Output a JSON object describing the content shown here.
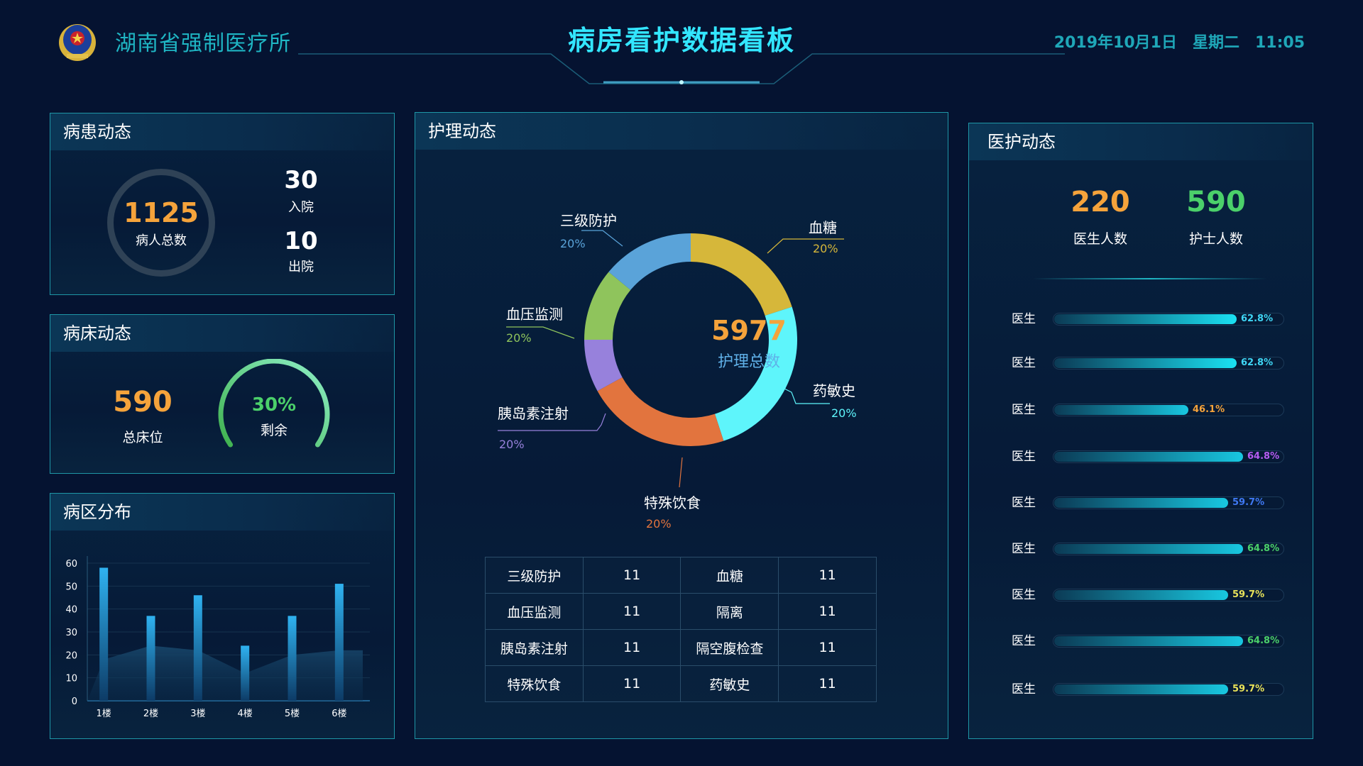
{
  "header": {
    "org_name": "湖南省强制医疗所",
    "title": "病房看护数据看板",
    "date": "2019年10月1日",
    "weekday": "星期二",
    "time": "11:05"
  },
  "patient_panel": {
    "title": "病患动态",
    "total": "1125",
    "total_label": "病人总数",
    "admitted": "30",
    "admitted_label": "入院",
    "discharged": "10",
    "discharged_label": "出院"
  },
  "bed_panel": {
    "title": "病床动态",
    "total": "590",
    "total_label": "总床位",
    "remaining_pct": "30%",
    "remaining_fraction": 0.3,
    "remaining_label": "剩余"
  },
  "ward_panel": {
    "title": "病区分布",
    "chart_data": {
      "type": "bar",
      "categories": [
        "1楼",
        "2楼",
        "3楼",
        "4楼",
        "5楼",
        "6楼"
      ],
      "values": [
        58,
        37,
        46,
        24,
        37,
        51
      ],
      "area_values": [
        18,
        24,
        22,
        12,
        20,
        22
      ],
      "ylim": [
        0,
        60
      ],
      "yticks": [
        "0",
        "10",
        "20",
        "30",
        "40",
        "50",
        "60"
      ],
      "colors": {
        "bar": "#2a9fd8",
        "area": "#18476b"
      }
    }
  },
  "nursing_panel": {
    "title": "护理动态",
    "total": "5977",
    "total_label": "护理总数",
    "chart_data": {
      "type": "pie",
      "segments": [
        {
          "name": "血糖",
          "value": 20,
          "label": "20%",
          "color": "#d6b73a"
        },
        {
          "name": "药敏史",
          "value": 25,
          "label": "20%",
          "color": "#5ef5fb"
        },
        {
          "name": "特殊饮食",
          "value": 22,
          "label": "20%",
          "color": "#e2743e"
        },
        {
          "name": "胰岛素注射",
          "value": 8,
          "label": "20%",
          "color": "#9781dc"
        },
        {
          "name": "血压监测",
          "value": 11,
          "label": "20%",
          "color": "#8fc45c"
        },
        {
          "name": "三级防护",
          "value": 14,
          "label": "20%",
          "color": "#5aa3d9"
        }
      ]
    },
    "table": [
      [
        "三级防护",
        "11",
        "血糖",
        "11"
      ],
      [
        "血压监测",
        "11",
        "隔离",
        "11"
      ],
      [
        "胰岛素注射",
        "11",
        "隔空腹检查",
        "11"
      ],
      [
        "特殊饮食",
        "11",
        "药敏史",
        "11"
      ]
    ]
  },
  "medical_panel": {
    "title": "医护动态",
    "doctor_count": "220",
    "doctor_label": "医生人数",
    "nurse_count": "590",
    "nurse_label": "护士人数",
    "bars": [
      {
        "label": "医生",
        "value": 62.8,
        "text": "62.8%",
        "color": "#3fd6f5"
      },
      {
        "label": "医生",
        "value": 62.8,
        "text": "62.8%",
        "color": "#3fd6f5"
      },
      {
        "label": "医生",
        "value": 46.1,
        "text": "46.1%",
        "color": "#f5a33b"
      },
      {
        "label": "医生",
        "value": 64.8,
        "text": "64.8%",
        "color": "#b65cf2"
      },
      {
        "label": "医生",
        "value": 59.7,
        "text": "59.7%",
        "color": "#3f78f2"
      },
      {
        "label": "医生",
        "value": 64.8,
        "text": "64.8%",
        "color": "#4bd06a"
      },
      {
        "label": "医生",
        "value": 59.7,
        "text": "59.7%",
        "color": "#e9e35a"
      },
      {
        "label": "医生",
        "value": 64.8,
        "text": "64.8%",
        "color": "#4bd06a"
      },
      {
        "label": "医生",
        "value": 59.7,
        "text": "59.7%",
        "color": "#e9e35a"
      }
    ]
  }
}
